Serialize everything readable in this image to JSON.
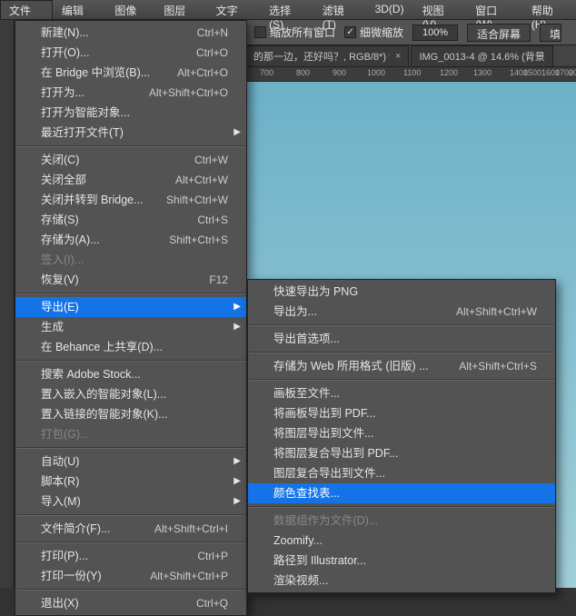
{
  "menubar": {
    "items": [
      {
        "label": "文件(F)"
      },
      {
        "label": "编辑(E)"
      },
      {
        "label": "图像(I)"
      },
      {
        "label": "图层(L)"
      },
      {
        "label": "文字(Y)"
      },
      {
        "label": "选择(S)"
      },
      {
        "label": "滤镜(T)"
      },
      {
        "label": "3D(D)"
      },
      {
        "label": "视图(V)"
      },
      {
        "label": "窗口(W)"
      },
      {
        "label": "帮助(H)"
      }
    ]
  },
  "optionbar": {
    "check1": "缩放所有窗口",
    "check2": "细微缩放",
    "zoom": "100%",
    "fit": "适合屏幕",
    "fill": "填"
  },
  "tabs": {
    "t1": "的那一边，还好吗？, RGB/8*) *",
    "t2": "IMG_0013-4 @ 14.6% (背景"
  },
  "ruler": {
    "t0": "700",
    "t1": "800",
    "t2": "900",
    "t3": "1000",
    "t4": "1100",
    "t5": "1200",
    "t6": "1300",
    "t7": "1400",
    "t8": "1500",
    "t9": "1600",
    "t10": "1700",
    "t11": "2000"
  },
  "file_menu": [
    {
      "label": "新建(N)...",
      "sc": "Ctrl+N"
    },
    {
      "label": "打开(O)...",
      "sc": "Ctrl+O"
    },
    {
      "label": "在 Bridge 中浏览(B)...",
      "sc": "Alt+Ctrl+O"
    },
    {
      "label": "打开为...",
      "sc": "Alt+Shift+Ctrl+O"
    },
    {
      "label": "打开为智能对象..."
    },
    {
      "label": "最近打开文件(T)",
      "sub": true
    },
    {
      "sep": true
    },
    {
      "label": "关闭(C)",
      "sc": "Ctrl+W"
    },
    {
      "label": "关闭全部",
      "sc": "Alt+Ctrl+W"
    },
    {
      "label": "关闭并转到 Bridge...",
      "sc": "Shift+Ctrl+W"
    },
    {
      "label": "存储(S)",
      "sc": "Ctrl+S"
    },
    {
      "label": "存储为(A)...",
      "sc": "Shift+Ctrl+S"
    },
    {
      "label": "签入(I)...",
      "disabled": true
    },
    {
      "label": "恢复(V)",
      "sc": "F12"
    },
    {
      "sep": true
    },
    {
      "label": "导出(E)",
      "sub": true,
      "hl": true
    },
    {
      "label": "生成",
      "sub": true
    },
    {
      "label": "在 Behance 上共享(D)..."
    },
    {
      "sep": true
    },
    {
      "label": "搜索 Adobe Stock..."
    },
    {
      "label": "置入嵌入的智能对象(L)..."
    },
    {
      "label": "置入链接的智能对象(K)..."
    },
    {
      "label": "打包(G)...",
      "disabled": true
    },
    {
      "sep": true
    },
    {
      "label": "自动(U)",
      "sub": true
    },
    {
      "label": "脚本(R)",
      "sub": true
    },
    {
      "label": "导入(M)",
      "sub": true
    },
    {
      "sep": true
    },
    {
      "label": "文件简介(F)...",
      "sc": "Alt+Shift+Ctrl+I"
    },
    {
      "sep": true
    },
    {
      "label": "打印(P)...",
      "sc": "Ctrl+P"
    },
    {
      "label": "打印一份(Y)",
      "sc": "Alt+Shift+Ctrl+P"
    },
    {
      "sep": true
    },
    {
      "label": "退出(X)",
      "sc": "Ctrl+Q"
    }
  ],
  "export_menu": [
    {
      "label": "快速导出为 PNG"
    },
    {
      "label": "导出为...",
      "sc": "Alt+Shift+Ctrl+W"
    },
    {
      "sep": true
    },
    {
      "label": "导出首选项..."
    },
    {
      "sep": true
    },
    {
      "label": "存储为 Web 所用格式 (旧版) ...",
      "sc": "Alt+Shift+Ctrl+S"
    },
    {
      "sep": true
    },
    {
      "label": "画板至文件..."
    },
    {
      "label": "将画板导出到 PDF..."
    },
    {
      "label": "将图层导出到文件..."
    },
    {
      "label": "将图层复合导出到 PDF..."
    },
    {
      "label": "图层复合导出到文件..."
    },
    {
      "label": "颜色查找表...",
      "hl": true
    },
    {
      "sep": true
    },
    {
      "label": "数据组作为文件(D)...",
      "disabled": true
    },
    {
      "label": "Zoomify..."
    },
    {
      "label": "路径到 Illustrator..."
    },
    {
      "label": "渲染视频..."
    }
  ]
}
